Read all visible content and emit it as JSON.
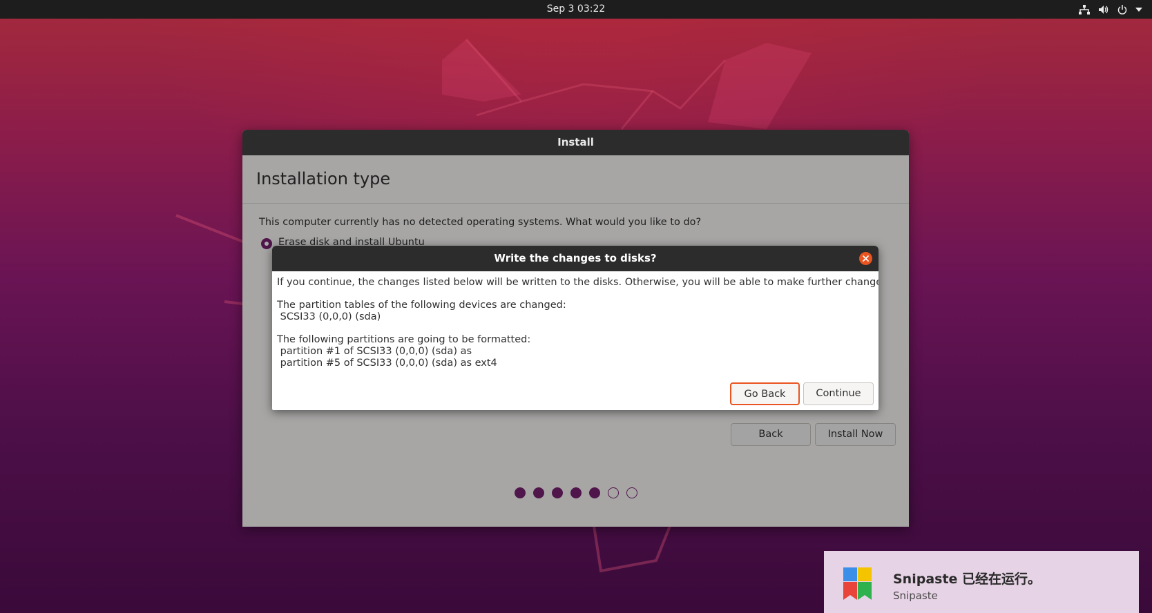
{
  "topbar": {
    "clock": "Sep 3  03:22",
    "tray_icons": [
      "network-icon",
      "volume-icon",
      "power-icon",
      "menu-arrow-icon"
    ]
  },
  "installer": {
    "window_title": "Install",
    "page_title": "Installation type",
    "question": "This computer currently has no detected operating systems. What would you like to do?",
    "selected_option": "Erase disk and install Ubuntu",
    "back_label": "Back",
    "install_now_label": "Install Now",
    "progress": {
      "total_steps": 7,
      "completed_steps": 5
    }
  },
  "dialog": {
    "title": "Write the changes to disks?",
    "intro": "If you continue, the changes listed below will be written to the disks. Otherwise, you will be able to make further changes manually.",
    "partition_tables_heading": "The partition tables of the following devices are changed:",
    "partition_tables_device": " SCSI33 (0,0,0) (sda)",
    "formatted_heading": "The following partitions are going to be formatted:",
    "formatted_item_1": " partition #1 of SCSI33 (0,0,0) (sda) as",
    "formatted_item_2": " partition #5 of SCSI33 (0,0,0) (sda) as ext4",
    "go_back_label": "Go Back",
    "continue_label": "Continue"
  },
  "notification": {
    "title": "Snipaste 已经在运行。",
    "subtitle": "Snipaste"
  },
  "colors": {
    "ubuntu_orange": "#e95420",
    "aubergine": "#77216f",
    "topbar": "#1d1d1d",
    "titlebar": "#2c2c2c"
  }
}
